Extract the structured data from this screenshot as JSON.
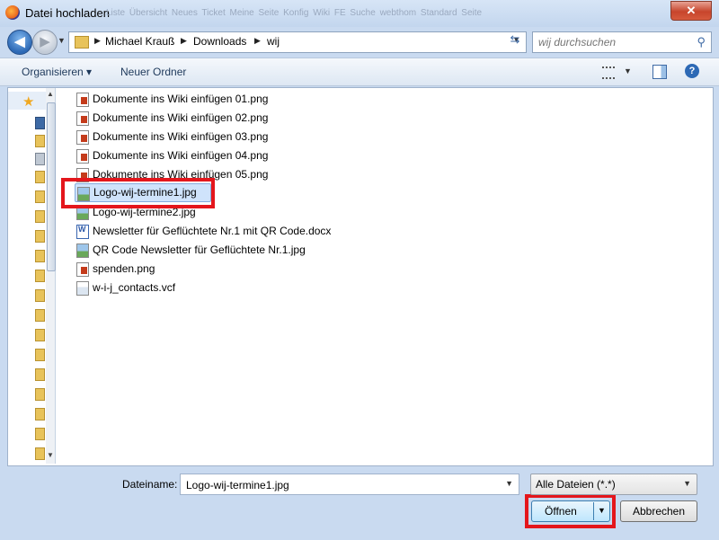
{
  "window": {
    "title": "Datei hochladen",
    "ghost_tabs": "Liste Übersicht   Neues Ticket   Meine Seite   Konfig   Wiki FE   Suche   webthom   Standard Seite",
    "close_label": "✕"
  },
  "nav": {
    "back_label": "◀",
    "forward_label": "▶",
    "breadcrumbs": [
      "Michael Krauß",
      "Downloads",
      "wij"
    ],
    "search_placeholder": "wij durchsuchen"
  },
  "toolbar": {
    "organize_label": "Organisieren ▾",
    "new_folder_label": "Neuer Ordner",
    "help_label": "?"
  },
  "files": [
    {
      "name": "Dokumente ins Wiki einfügen 01.png",
      "type": "png"
    },
    {
      "name": "Dokumente ins Wiki einfügen 02.png",
      "type": "png"
    },
    {
      "name": "Dokumente ins Wiki einfügen 03.png",
      "type": "png"
    },
    {
      "name": "Dokumente ins Wiki einfügen 04.png",
      "type": "png"
    },
    {
      "name": "Dokumente ins Wiki einfügen 05.png",
      "type": "png"
    },
    {
      "name": "Logo-wij-termine1.jpg",
      "type": "jpg",
      "selected": true
    },
    {
      "name": "Logo-wij-termine2.jpg",
      "type": "jpg"
    },
    {
      "name": "Newsletter für Geflüchtete Nr.1 mit QR Code.docx",
      "type": "docx"
    },
    {
      "name": "QR Code Newsletter für Geflüchtete Nr.1.jpg",
      "type": "jpg"
    },
    {
      "name": "spenden.png",
      "type": "png"
    },
    {
      "name": "w-i-j_contacts.vcf",
      "type": "vcf"
    }
  ],
  "bottom": {
    "filename_label": "Dateiname:",
    "filename_value": "Logo-wij-termine1.jpg",
    "filetype_value": "Alle Dateien (*.*)",
    "open_label": "Öffnen",
    "cancel_label": "Abbrechen"
  },
  "colors": {
    "highlight": "#e4161c",
    "selection": "#cfe3fb",
    "window_frame": "#c9daf0"
  }
}
